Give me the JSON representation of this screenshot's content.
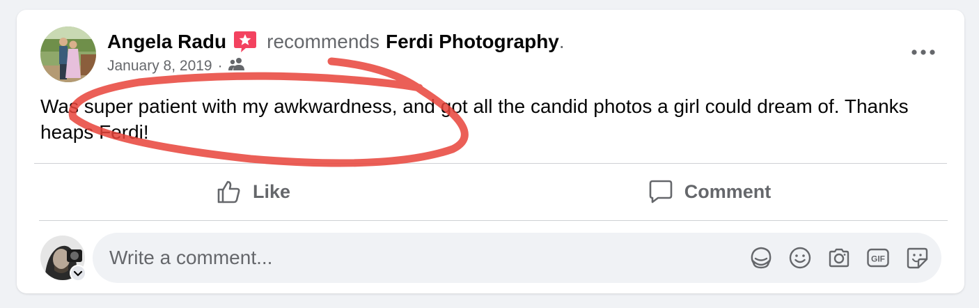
{
  "post": {
    "author": "Angela Radu",
    "action": "recommends",
    "page": "Ferdi Photography",
    "period": ".",
    "date": "January 8, 2019",
    "separator": "·",
    "audience_icon": "friends-icon",
    "text": "Was super patient with my awkwardness, and got all the candid photos a girl could dream of. Thanks heaps Ferdi!"
  },
  "actions": {
    "like_label": "Like",
    "comment_label": "Comment"
  },
  "comment_box": {
    "placeholder": "Write a comment...",
    "tools": [
      "avatar-sticker-icon",
      "emoji-icon",
      "camera-icon",
      "gif-icon",
      "sticker-icon"
    ]
  },
  "colors": {
    "background": "#f0f2f5",
    "card": "#ffffff",
    "text_primary": "#050505",
    "text_secondary": "#65676b",
    "recommend_badge": "#f3425f",
    "annotation": "#e8433a"
  }
}
